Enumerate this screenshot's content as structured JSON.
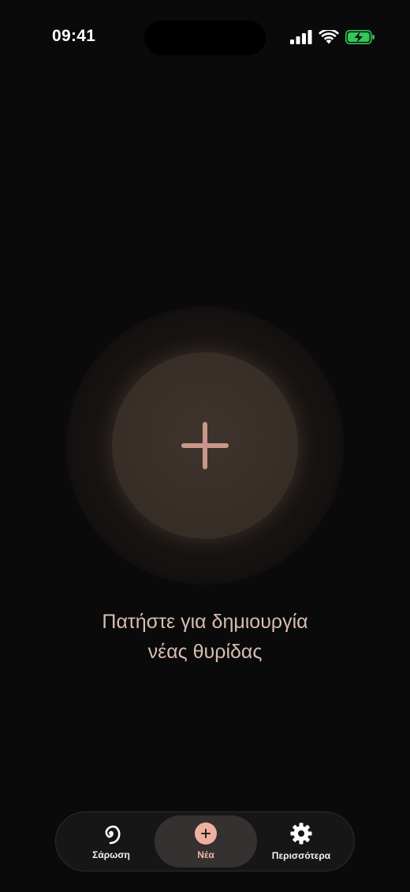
{
  "status": {
    "time": "09:41"
  },
  "main": {
    "prompt_line1": "Πατήστε για δημιουργία",
    "prompt_line2": "νέας θυρίδας",
    "add_icon": "plus-icon"
  },
  "tabs": [
    {
      "label": "Σάρωση",
      "icon": "spiral-icon"
    },
    {
      "label": "Νέα",
      "icon": "plus-circle-icon",
      "selected": true
    },
    {
      "label": "Περισσότερα",
      "icon": "gear-icon"
    }
  ],
  "colors": {
    "accent": "#efb0a2",
    "background": "#0b0a0a",
    "circle": "#392e28"
  }
}
